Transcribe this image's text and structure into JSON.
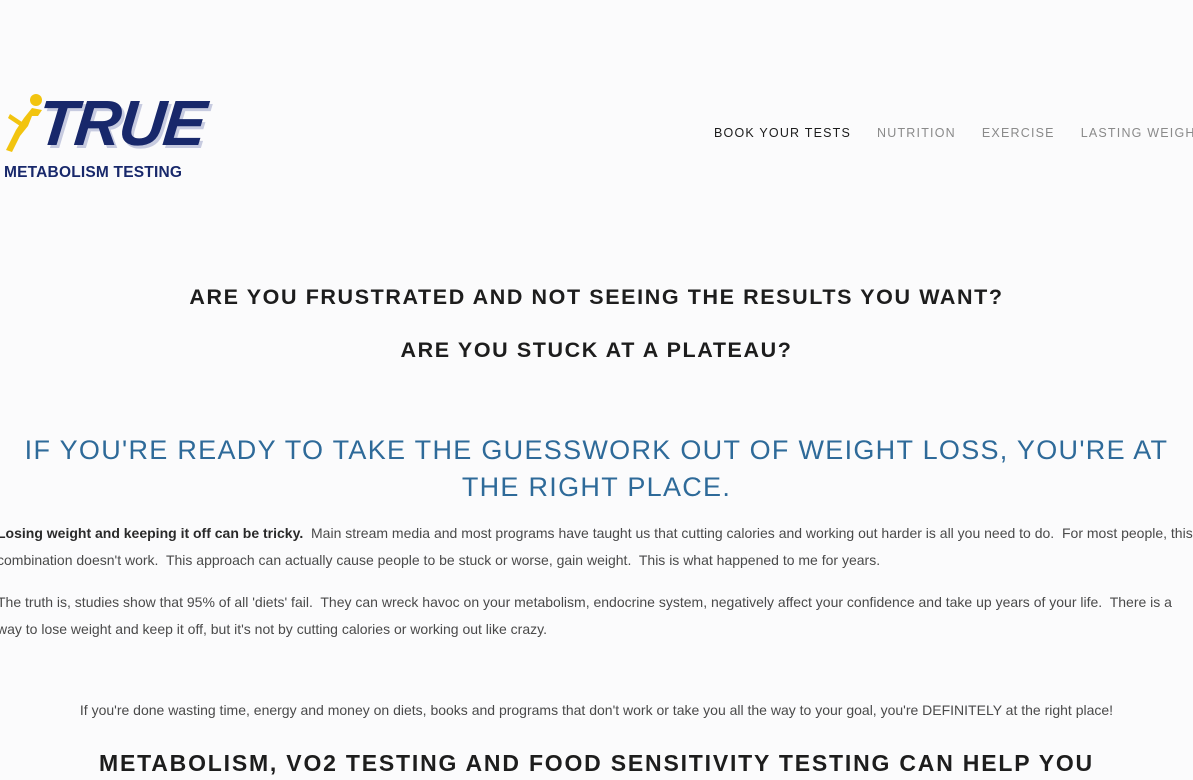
{
  "brand": {
    "wordmark": "TRUE",
    "tagline": "METABOLISM TESTING",
    "colors": {
      "navy": "#18286b",
      "yellow": "#f2c40f"
    }
  },
  "nav": {
    "items": [
      {
        "label": "BOOK YOUR TESTS",
        "active": true
      },
      {
        "label": "NUTRITION",
        "active": false
      },
      {
        "label": "EXERCISE",
        "active": false
      },
      {
        "label": "LASTING WEIGHT LOSS",
        "active": false
      }
    ]
  },
  "main": {
    "question_1": "ARE YOU FRUSTRATED AND NOT SEEING THE RESULTS YOU WANT?",
    "question_2": "ARE YOU STUCK AT A PLATEAU?",
    "ready_heading": "IF YOU'RE READY TO TAKE THE GUESSWORK OUT OF WEIGHT LOSS, YOU'RE AT THE RIGHT PLACE.",
    "paragraph_1_bold": "Losing weight and keeping it off can be tricky.",
    "paragraph_1_rest": "  Main stream media and most programs have taught us that cutting calories and working out harder is all you need to do.  For most people, this combination doesn't work.  This approach can actually cause people to be stuck or worse, gain weight.  This is what happened to me for years.",
    "paragraph_2": "The truth is, studies show that 95% of all 'diets' fail.  They can wreck havoc on your metabolism, endocrine system, negatively affect your confidence and take up years of your life.  There is a way to lose weight and keep it off, but it's not by cutting calories or working out like crazy.",
    "done_line": "If you're done wasting time, energy and money on diets, books and programs that don't work or take you all the way to your goal, you're DEFINITELY at the right place!",
    "cta_heading": "METABOLISM, VO2 TESTING AND FOOD SENSITIVITY TESTING CAN HELP YOU"
  },
  "icons": {
    "logo_mark": "runner-icon"
  },
  "colors": {
    "background": "#fbfbfc",
    "heading": "#1d1d1d",
    "accent_blue": "#2e6a99",
    "body_text": "#4a4a4a",
    "nav_inactive": "#8a8a8a"
  }
}
